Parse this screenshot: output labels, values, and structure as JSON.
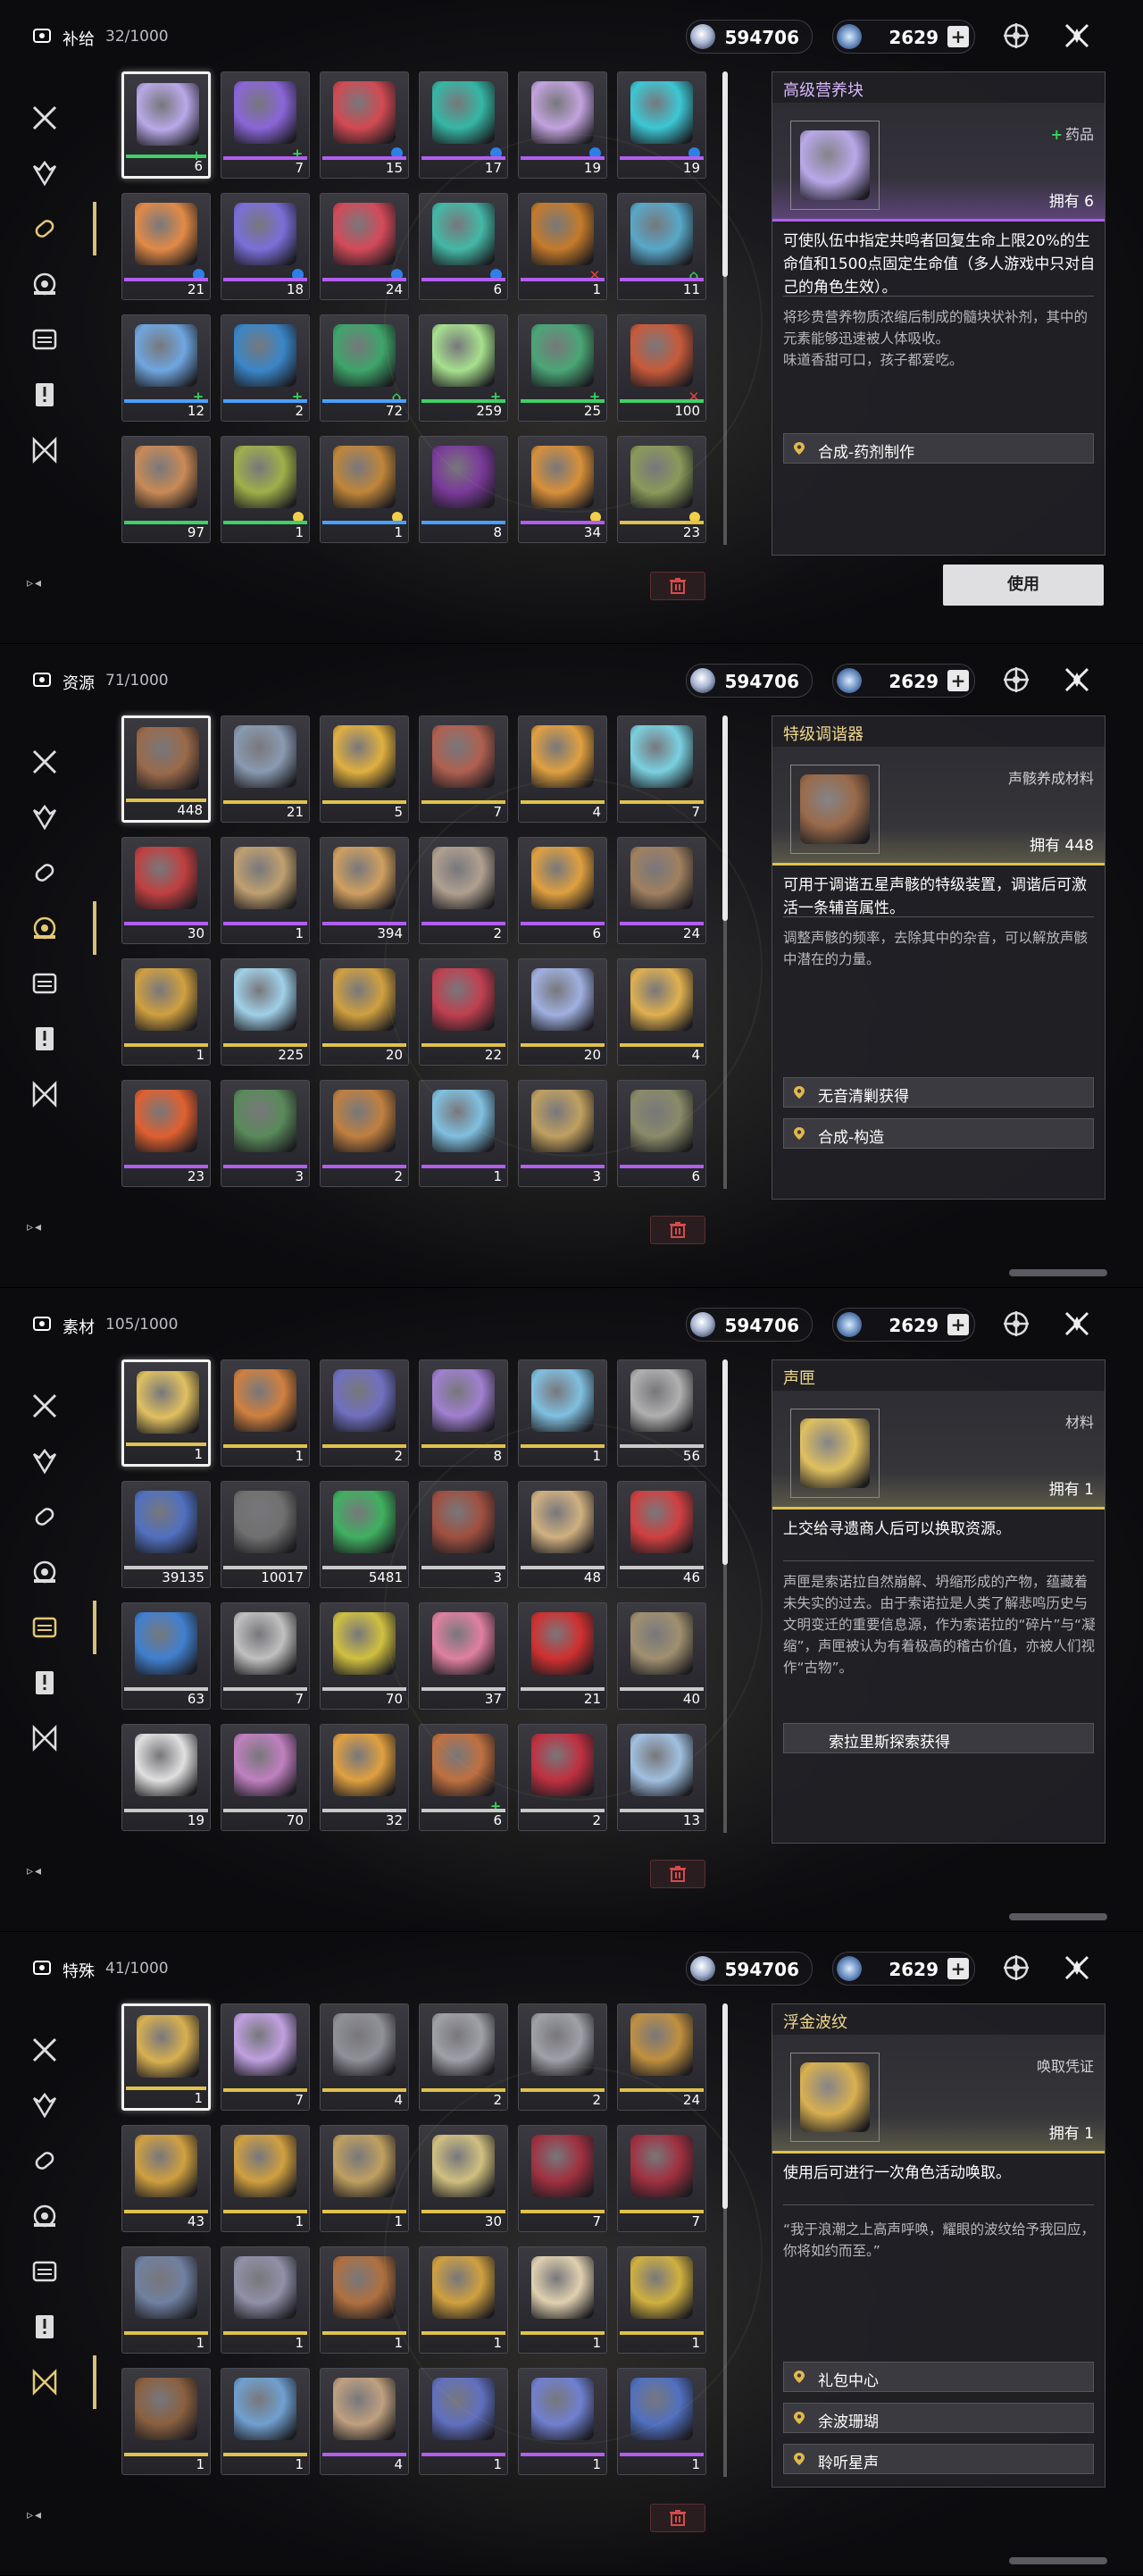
{
  "header": {
    "currency1_value": "594706",
    "currency2_value": "2629",
    "currency2_plus": "+"
  },
  "panels": [
    {
      "category": "补给",
      "count": "32/1000",
      "active_side_index": 2,
      "items": [
        {
          "count": "6",
          "bar": "green",
          "badge": "plus",
          "color": "#b9a8e8"
        },
        {
          "count": "7",
          "bar": "purple",
          "badge": "plus",
          "color": "#8a66d8"
        },
        {
          "count": "15",
          "bar": "purple",
          "badge": "dot",
          "color": "#d24a52"
        },
        {
          "count": "17",
          "bar": "purple",
          "badge": "dot",
          "color": "#35b7a5"
        },
        {
          "count": "19",
          "bar": "purple",
          "badge": "dot",
          "color": "#c2a3de"
        },
        {
          "count": "19",
          "bar": "purple",
          "badge": "dot",
          "color": "#3dc7d4"
        },
        {
          "count": "21",
          "bar": "purple",
          "badge": "dot",
          "color": "#e28a47"
        },
        {
          "count": "18",
          "bar": "purple",
          "badge": "dot",
          "color": "#7a6fd9"
        },
        {
          "count": "24",
          "bar": "purple",
          "badge": "dot",
          "color": "#d44a59"
        },
        {
          "count": "6",
          "bar": "purple",
          "badge": "dot",
          "color": "#44b8a6"
        },
        {
          "count": "1",
          "bar": "purple",
          "badge": "x",
          "color": "#c47a2a"
        },
        {
          "count": "11",
          "bar": "purple",
          "badge": "leaf",
          "color": "#58a8c8"
        },
        {
          "count": "12",
          "bar": "blue",
          "badge": "plus",
          "color": "#6fa6e0"
        },
        {
          "count": "2",
          "bar": "blue",
          "badge": "plus",
          "color": "#3a86c8"
        },
        {
          "count": "72",
          "bar": "blue",
          "badge": "leaf",
          "color": "#3da56a"
        },
        {
          "count": "259",
          "bar": "green",
          "badge": "plus",
          "color": "#a7e08e"
        },
        {
          "count": "25",
          "bar": "green",
          "badge": "plus",
          "color": "#4aa676"
        },
        {
          "count": "100",
          "bar": "green",
          "badge": "x",
          "color": "#c85a3a"
        },
        {
          "count": "97",
          "bar": "green",
          "badge": "",
          "color": "#c98a56"
        },
        {
          "count": "1",
          "bar": "green",
          "badge": "bulb",
          "color": "#9fb04a"
        },
        {
          "count": "1",
          "bar": "blue",
          "badge": "bulb",
          "color": "#c0863a"
        },
        {
          "count": "8",
          "bar": "blue",
          "badge": "",
          "color": "#7a3a9a"
        },
        {
          "count": "34",
          "bar": "purple",
          "badge": "bulb",
          "color": "#d8903a"
        },
        {
          "count": "23",
          "bar": "gold",
          "badge": "bulb",
          "color": "#8a9a5a"
        }
      ],
      "detail": {
        "title": "高级营养块",
        "title_color": "purple",
        "type_plus": "+",
        "type": "药品",
        "own": "拥有 6",
        "desc": "可使队伍中指定共鸣者回复生命上限20%的生命值和1500点固定生命值（多人游戏中只对自己的角色生效）。",
        "lore": "将珍贵营养物质浓缩后制成的髓块状补剂，其中的元素能够迅速被人体吸收。\n味道香甜可口，孩子都爱吃。",
        "sources": [
          "合成-药剂制作"
        ],
        "use_label": "使用",
        "art_color": "#b9a8e8"
      }
    },
    {
      "category": "资源",
      "count": "71/1000",
      "active_side_index": 3,
      "items": [
        {
          "count": "448",
          "bar": "gold",
          "badge": "",
          "color": "#9a6a4a"
        },
        {
          "count": "21",
          "bar": "gold",
          "badge": "",
          "color": "#8a9ab0"
        },
        {
          "count": "5",
          "bar": "gold",
          "badge": "",
          "color": "#e0b040"
        },
        {
          "count": "7",
          "bar": "gold",
          "badge": "",
          "color": "#b06050"
        },
        {
          "count": "4",
          "bar": "gold",
          "badge": "",
          "color": "#e0a040"
        },
        {
          "count": "7",
          "bar": "gold",
          "badge": "",
          "color": "#7ad0e0"
        },
        {
          "count": "30",
          "bar": "purple",
          "badge": "",
          "color": "#c04040"
        },
        {
          "count": "1",
          "bar": "purple",
          "badge": "",
          "color": "#c0a070"
        },
        {
          "count": "394",
          "bar": "purple",
          "badge": "",
          "color": "#d0a060"
        },
        {
          "count": "2",
          "bar": "purple",
          "badge": "",
          "color": "#b0a090"
        },
        {
          "count": "6",
          "bar": "purple",
          "badge": "",
          "color": "#e0a040"
        },
        {
          "count": "24",
          "bar": "purple",
          "badge": "",
          "color": "#a08060"
        },
        {
          "count": "1",
          "bar": "gold",
          "badge": "",
          "color": "#d0a040"
        },
        {
          "count": "225",
          "bar": "gold",
          "badge": "",
          "color": "#a0d0e8"
        },
        {
          "count": "20",
          "bar": "gold",
          "badge": "",
          "color": "#d0a040"
        },
        {
          "count": "22",
          "bar": "gold",
          "badge": "",
          "color": "#c04050"
        },
        {
          "count": "20",
          "bar": "gold",
          "badge": "",
          "color": "#a0b0e0"
        },
        {
          "count": "4",
          "bar": "gold",
          "badge": "",
          "color": "#e0b050"
        },
        {
          "count": "23",
          "bar": "purple",
          "badge": "",
          "color": "#e06030"
        },
        {
          "count": "3",
          "bar": "purple",
          "badge": "",
          "color": "#5a8a5a"
        },
        {
          "count": "2",
          "bar": "purple",
          "badge": "",
          "color": "#c08040"
        },
        {
          "count": "1",
          "bar": "purple",
          "badge": "",
          "color": "#80c0e0"
        },
        {
          "count": "3",
          "bar": "purple",
          "badge": "",
          "color": "#c0a060"
        },
        {
          "count": "6",
          "bar": "purple",
          "badge": "",
          "color": "#8a8a6a"
        }
      ],
      "detail": {
        "title": "特级调谐器",
        "title_color": "gold",
        "type_plus": "",
        "type": "声骸养成材料",
        "own": "拥有 448",
        "desc": "可用于调谐五星声骸的特级装置，调谐后可激活一条辅音属性。",
        "lore": "调整声骸的频率，去除其中的杂音，可以解放声骸中潜在的力量。",
        "sources": [
          "无音清剿获得",
          "合成-构造"
        ],
        "use_label": "",
        "art_color": "#9a6a4a"
      }
    },
    {
      "category": "素材",
      "count": "105/1000",
      "active_side_index": 4,
      "items": [
        {
          "count": "1",
          "bar": "gold",
          "badge": "",
          "color": "#e0c060"
        },
        {
          "count": "1",
          "bar": "gold",
          "badge": "",
          "color": "#d08040"
        },
        {
          "count": "2",
          "bar": "gold",
          "badge": "",
          "color": "#7070c0"
        },
        {
          "count": "8",
          "bar": "gold",
          "badge": "",
          "color": "#a080d0"
        },
        {
          "count": "1",
          "bar": "gold",
          "badge": "",
          "color": "#80c0e0"
        },
        {
          "count": "56",
          "bar": "white",
          "badge": "",
          "color": "#b0b0b0"
        },
        {
          "count": "39135",
          "bar": "white",
          "badge": "",
          "color": "#5070c0"
        },
        {
          "count": "10017",
          "bar": "white",
          "badge": "",
          "color": "#707070"
        },
        {
          "count": "5481",
          "bar": "white",
          "badge": "",
          "color": "#40b060"
        },
        {
          "count": "3",
          "bar": "white",
          "badge": "",
          "color": "#a05040"
        },
        {
          "count": "48",
          "bar": "white",
          "badge": "",
          "color": "#d0b080"
        },
        {
          "count": "46",
          "bar": "white",
          "badge": "",
          "color": "#d04040"
        },
        {
          "count": "63",
          "bar": "white",
          "badge": "",
          "color": "#4080d0"
        },
        {
          "count": "7",
          "bar": "white",
          "badge": "",
          "color": "#c0c0c0"
        },
        {
          "count": "70",
          "bar": "white",
          "badge": "",
          "color": "#d0c040"
        },
        {
          "count": "37",
          "bar": "white",
          "badge": "",
          "color": "#e080a0"
        },
        {
          "count": "21",
          "bar": "white",
          "badge": "",
          "color": "#d03030"
        },
        {
          "count": "40",
          "bar": "white",
          "badge": "",
          "color": "#a09070"
        },
        {
          "count": "19",
          "bar": "white",
          "badge": "",
          "color": "#e0e0e0"
        },
        {
          "count": "70",
          "bar": "white",
          "badge": "",
          "color": "#c080c0"
        },
        {
          "count": "32",
          "bar": "white",
          "badge": "",
          "color": "#e0a040"
        },
        {
          "count": "6",
          "bar": "white",
          "badge": "plus",
          "color": "#c07040"
        },
        {
          "count": "2",
          "bar": "white",
          "badge": "",
          "color": "#c03040"
        },
        {
          "count": "13",
          "bar": "white",
          "badge": "",
          "color": "#a0c0e0"
        }
      ],
      "detail": {
        "title": "声匣",
        "title_color": "gold",
        "type_plus": "",
        "type": "材料",
        "own": "拥有 1",
        "desc": "上交给寻遗商人后可以换取资源。",
        "lore": "声匣是索诺拉自然崩解、坍缩形成的产物，蕴藏着未失实的过去。由于索诺拉是人类了解悲鸣历史与文明变迁的重要信息源，作为索诺拉的“碎片”与“凝缩”，声匣被认为有着极高的稽古价值，亦被人们视作“古物”。",
        "sources": [
          "索拉里斯探索获得"
        ],
        "use_label": "",
        "art_color": "#e0c060"
      }
    },
    {
      "category": "特殊",
      "count": "41/1000",
      "active_side_index": 6,
      "items": [
        {
          "count": "1",
          "bar": "gold",
          "badge": "",
          "color": "#d8b050"
        },
        {
          "count": "7",
          "bar": "gold",
          "badge": "",
          "color": "#c0a0e0"
        },
        {
          "count": "4",
          "bar": "gold",
          "badge": "",
          "color": "#909098"
        },
        {
          "count": "2",
          "bar": "gold",
          "badge": "",
          "color": "#a0a0a8"
        },
        {
          "count": "2",
          "bar": "gold",
          "badge": "",
          "color": "#a0a0a8"
        },
        {
          "count": "24",
          "bar": "gold",
          "badge": "",
          "color": "#c09040"
        },
        {
          "count": "43",
          "bar": "gold",
          "badge": "",
          "color": "#d0a040"
        },
        {
          "count": "1",
          "bar": "gold",
          "badge": "",
          "color": "#d0a040"
        },
        {
          "count": "1",
          "bar": "gold",
          "badge": "",
          "color": "#c0a060"
        },
        {
          "count": "30",
          "bar": "gold",
          "badge": "",
          "color": "#d0c080"
        },
        {
          "count": "7",
          "bar": "gold",
          "badge": "",
          "color": "#a03040"
        },
        {
          "count": "7",
          "bar": "gold",
          "badge": "",
          "color": "#a03040"
        },
        {
          "count": "1",
          "bar": "gold",
          "badge": "",
          "color": "#7080a0"
        },
        {
          "count": "1",
          "bar": "gold",
          "badge": "",
          "color": "#9090a8"
        },
        {
          "count": "1",
          "bar": "gold",
          "badge": "",
          "color": "#b07040"
        },
        {
          "count": "1",
          "bar": "gold",
          "badge": "",
          "color": "#d0a040"
        },
        {
          "count": "1",
          "bar": "gold",
          "badge": "",
          "color": "#e0d0b0"
        },
        {
          "count": "1",
          "bar": "gold",
          "badge": "",
          "color": "#d0b040"
        },
        {
          "count": "1",
          "bar": "gold",
          "badge": "",
          "color": "#8a6040"
        },
        {
          "count": "1",
          "bar": "gold",
          "badge": "",
          "color": "#70a0d0"
        },
        {
          "count": "4",
          "bar": "purple",
          "badge": "",
          "color": "#c0a080"
        },
        {
          "count": "1",
          "bar": "purple",
          "badge": "",
          "color": "#6070c0"
        },
        {
          "count": "1",
          "bar": "purple",
          "badge": "",
          "color": "#7080d0"
        },
        {
          "count": "1",
          "bar": "purple",
          "badge": "",
          "color": "#5070c0"
        }
      ],
      "detail": {
        "title": "浮金波纹",
        "title_color": "gold",
        "type_plus": "",
        "type": "唤取凭证",
        "own": "拥有 1",
        "desc": "使用后可进行一次角色活动唤取。",
        "lore": "“我于浪潮之上高声呼唤，耀眼的波纹给予我回应，你将如约而至。”",
        "sources": [
          "礼包中心",
          "余波珊瑚",
          "聆听星声"
        ],
        "use_label": "",
        "art_color": "#d8b050"
      }
    }
  ]
}
